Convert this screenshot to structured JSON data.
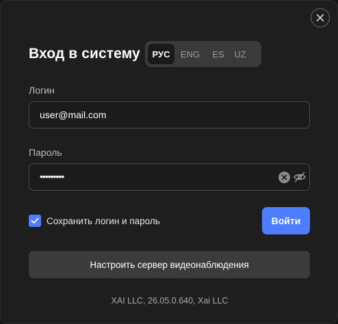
{
  "dialog": {
    "title": "Вход в систему",
    "close_icon": "close-icon"
  },
  "languages": {
    "selected": "РУС",
    "items": [
      "РУС",
      "ENG",
      "ES",
      "UZ"
    ]
  },
  "login": {
    "label": "Логин",
    "value": "user@mail.com"
  },
  "password": {
    "label": "Пароль",
    "value": "•••••••••",
    "icons": [
      "clear-icon",
      "eye-off-icon"
    ]
  },
  "remember": {
    "checked": true,
    "label": "Сохранить логин и пароль"
  },
  "buttons": {
    "login": "Войти",
    "configure_server": "Настроить сервер видеонаблюдения"
  },
  "footer": {
    "text": "XAI LLC, 26.05.0.640, Xai LLC"
  },
  "colors": {
    "accent": "#4f7dff",
    "background": "#1e1e1e",
    "secondary_button": "#3b3b3b"
  }
}
